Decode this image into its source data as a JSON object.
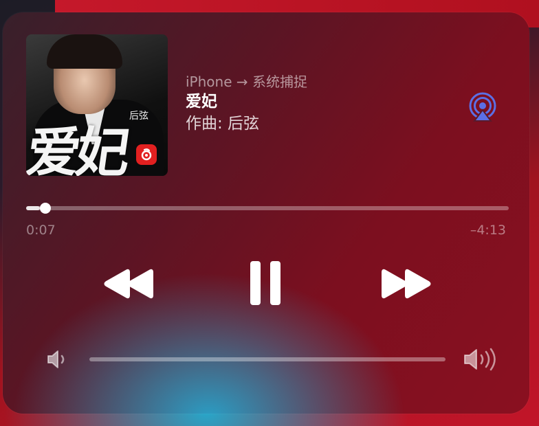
{
  "now_playing": {
    "route": "iPhone → 系统捕捉",
    "title": "爱妃",
    "subtitle": "作曲: 后弦",
    "artwork": {
      "big_text": "爱妃",
      "artist_text": "后弦",
      "badge_icon": "netease-music-icon"
    }
  },
  "playback": {
    "elapsed": "0:07",
    "remaining": "–4:13",
    "progress_fraction": 0.028,
    "state": "playing"
  },
  "volume": {
    "level_fraction": 0.0
  },
  "icons": {
    "airplay": "airplay-audio-icon",
    "rewind": "rewind-icon",
    "pause": "pause-icon",
    "forward": "fast-forward-icon",
    "volume_low": "speaker-low-icon",
    "volume_high": "speaker-high-icon"
  },
  "colors": {
    "accent_airplay": "#5b6fe6",
    "badge_red": "#e22020"
  }
}
